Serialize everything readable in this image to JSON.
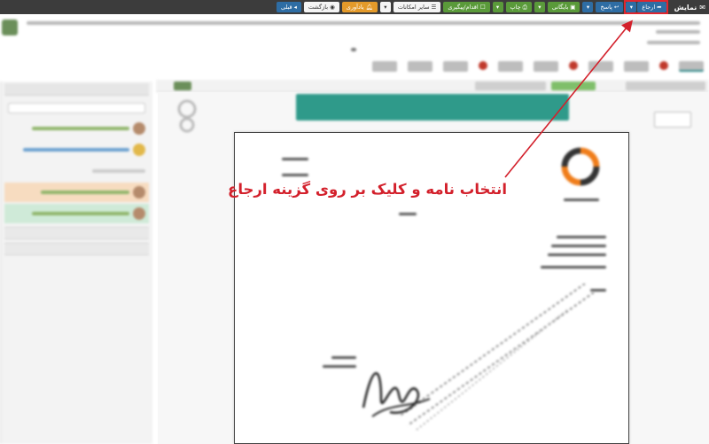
{
  "toolbar": {
    "window_title": "نمایش",
    "buttons": {
      "erja": "ارجاع",
      "pasokh": "پاسخ",
      "bayegani": "بایگانی",
      "chap": "چاپ",
      "eghdam": "اقدام/پیگیری",
      "sayer": "سایر امکانات",
      "yadavari": "یادآوری",
      "bazgasht": "بازگشت",
      "ghabli": "قبلی"
    }
  },
  "annotation": {
    "text": "انتخاب نامه و کلیک بر روی گزینه ارجاع"
  },
  "colors": {
    "highlight": "#e0262e",
    "banner": "#2f9a8a",
    "primary_button": "#2e6da4"
  }
}
